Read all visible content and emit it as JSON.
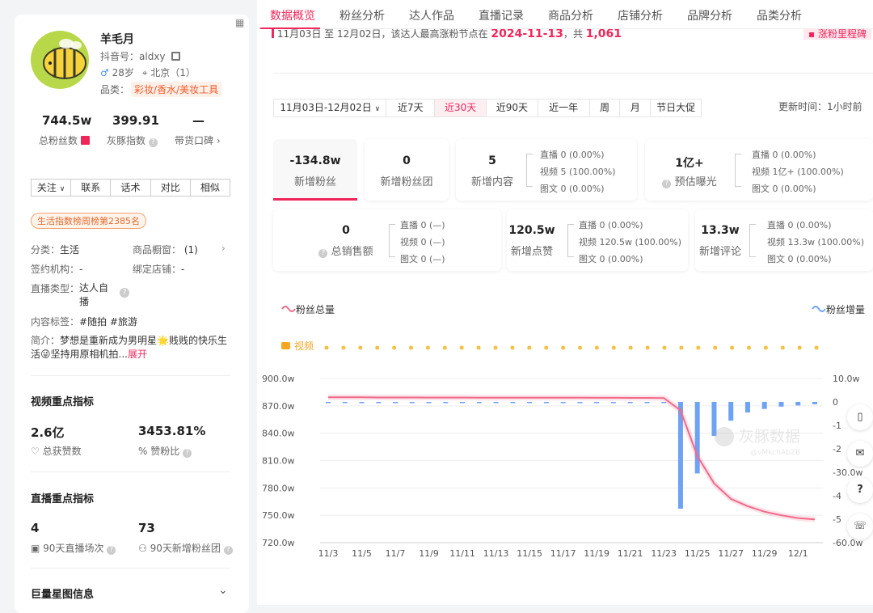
{
  "tabs": [
    "数据概览",
    "粉丝分析",
    "达人作品",
    "直播记录",
    "商品分析",
    "店铺分析",
    "品牌分析",
    "品类分析"
  ],
  "profile": {
    "name": "羊毛月",
    "douyin_label": "抖音号：",
    "douyin_id": "aldxy",
    "age": "28岁",
    "location": "北京（1）",
    "category_label": "品类：",
    "category": "彩妆/香水/美妆工具"
  },
  "stats": [
    {
      "value": "744.5w",
      "label": "总粉丝数"
    },
    {
      "value": "399.91",
      "label": "灰豚指数"
    },
    {
      "value": "—",
      "label": "带货口碑"
    }
  ],
  "buttons": [
    "关注",
    "联系",
    "话术",
    "对比",
    "相似"
  ],
  "rank_badge": "生活指数榜周榜第2385名",
  "info": {
    "fenlei_k": "分类：",
    "fenlei_v": "生活",
    "chuchuang_k": "商品橱窗：",
    "chuchuang_v": "(1)",
    "jigou_k": "签约机构：",
    "jigou_v": "-",
    "dianpu_k": "绑定店铺：",
    "dianpu_v": "-",
    "zhibo_k": "直播类型：",
    "zhibo_v1": "达人自",
    "zhibo_v2": "播",
    "tags_k": "内容标签：",
    "tags_v": "#随拍  #旅游",
    "intro_k": "简介：",
    "intro_1": "梦想是重新成为男明星",
    "intro_2": "贱贱的快乐生",
    "intro_3": "活",
    "intro_4": "坚持用原相机拍...",
    "intro_more": "展开"
  },
  "video_section": {
    "title": "视频重点指标",
    "v1": "2.6亿",
    "l1": "总获赞数",
    "v2": "3453.81%",
    "l2": "赞粉比"
  },
  "live_section": {
    "title": "直播重点指标",
    "v1": "4",
    "l1": "90天直播场次",
    "v2": "73",
    "l2": "90天新增粉丝团"
  },
  "star_section": {
    "title": "巨量星图信息"
  },
  "banner": {
    "text": "11月03日 至 12月02日，该达人最高涨粉节点在 ",
    "date": "2024-11-13",
    "mid": "，共 ",
    "count": "1,061",
    "button": "涨粉里程碑"
  },
  "date_range": "11月03日-12月02日",
  "periods": [
    "近7天",
    "近30天",
    "近90天",
    "近一年",
    "周",
    "月",
    "节日大促"
  ],
  "update": "更新时间：1小时前",
  "cards": [
    {
      "value": "-134.8w",
      "label": "新增粉丝"
    },
    {
      "value": "0",
      "label": "新增粉丝团"
    },
    {
      "value": "5",
      "label": "新增内容",
      "rows": [
        "直播  0 (0.00%)",
        "视频  5 (100.00%)",
        "图文  0 (0.00%)"
      ]
    },
    {
      "value": "1亿+",
      "label": "预估曝光",
      "rows": [
        "直播  0 (0.00%)",
        "视频  1亿+ (100.00%)",
        "图文  0 (0.00%)"
      ]
    },
    {
      "value": "0",
      "label": "总销售额",
      "rows": [
        "直播  0 (—)",
        "视频  0 (—)",
        "图文  0 (—)"
      ]
    },
    {
      "value": "120.5w",
      "label": "新增点赞",
      "rows": [
        "直播  0 (0.00%)",
        "视频  120.5w (100.00%)",
        "图文  0 (0.00%)"
      ]
    },
    {
      "value": "13.3w",
      "label": "新增评论",
      "rows": [
        "直播  0 (0.00%)",
        "视频  13.3w (100.00%)",
        "图文  0 (0.00%)"
      ]
    }
  ],
  "chart_data": {
    "type": "line",
    "series": [
      {
        "name": "粉丝总量",
        "axis": "left",
        "color": "#f06a8a",
        "values": [
          879.4,
          879.3,
          879.3,
          879.2,
          879.2,
          879.2,
          879.1,
          879.1,
          879.1,
          879.0,
          879.0,
          879.0,
          879.0,
          878.9,
          878.9,
          878.9,
          878.8,
          878.8,
          878.7,
          878.7,
          878.5,
          865,
          815,
          785,
          768,
          760,
          754,
          750,
          747,
          745.5
        ]
      },
      {
        "name": "粉丝增量",
        "axis": "right",
        "type": "bar",
        "color": "#6ea2f5",
        "values": [
          0,
          0,
          0,
          0,
          0,
          0,
          0,
          0,
          0,
          0,
          0,
          0,
          0,
          0,
          0,
          0,
          0,
          0,
          0,
          0,
          0,
          -45.5,
          -30.5,
          -14.5,
          -8,
          -4.5,
          -3,
          -2,
          -1.5,
          -1
        ]
      }
    ],
    "x": [
      "11/3",
      "11/4",
      "11/5",
      "11/6",
      "11/7",
      "11/8",
      "11/9",
      "11/10",
      "11/11",
      "11/12",
      "11/13",
      "11/14",
      "11/15",
      "11/16",
      "11/17",
      "11/18",
      "11/19",
      "11/20",
      "11/21",
      "11/22",
      "11/23",
      "11/24",
      "11/25",
      "11/26",
      "11/27",
      "11/28",
      "11/29",
      "11/30",
      "12/1",
      "12/2"
    ],
    "xticks": [
      "11/3",
      "11/5",
      "11/7",
      "11/9",
      "11/11",
      "11/13",
      "11/15",
      "11/17",
      "11/19",
      "11/21",
      "11/23",
      "11/25",
      "11/27",
      "11/29",
      "12/1"
    ],
    "y_left_ticks": [
      "900.0w",
      "870.0w",
      "840.0w",
      "810.0w",
      "780.0w",
      "750.0w",
      "720.0w"
    ],
    "y_right_ticks": [
      "10.0w",
      "0",
      "-1",
      "-2",
      "-30.0w",
      "-4",
      "-5",
      "-60.0w"
    ],
    "ylim_left": [
      720,
      900
    ],
    "ylim_right": [
      -60,
      10
    ],
    "event_label": "视频",
    "watermark": "灰豚数据",
    "watermark_id": "@vMkchAbZB"
  }
}
